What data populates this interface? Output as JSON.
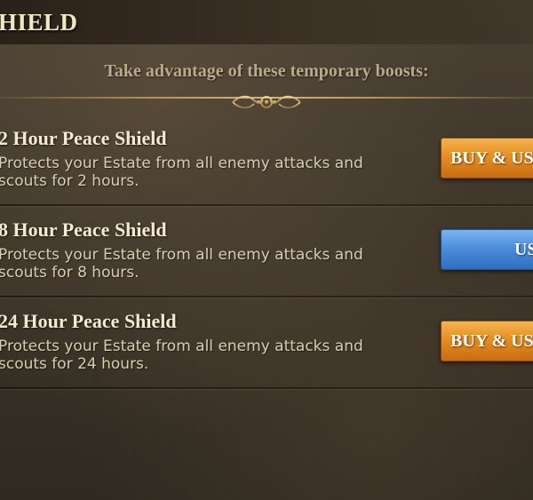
{
  "header": {
    "title": "HIELD",
    "subtitle": "Take advantage of these temporary boosts:"
  },
  "items": [
    {
      "title": "2 Hour Peace Shield",
      "description": "Protects your Estate from all enemy attacks and scouts for 2 hours.",
      "button_label": "BUY & US",
      "button_color": "#e58f24"
    },
    {
      "title": "8 Hour Peace Shield",
      "description": "Protects your Estate from all enemy attacks and scouts for 8 hours.",
      "button_label": "US",
      "button_color": "#4b8fdc"
    },
    {
      "title": "24 Hour Peace Shield",
      "description": "Protects your Estate from all enemy attacks and scouts for 24 hours.",
      "button_label": "BUY & US",
      "button_color": "#e58f24"
    }
  ],
  "icons": {
    "divider_ornament": "ornament-icon"
  }
}
